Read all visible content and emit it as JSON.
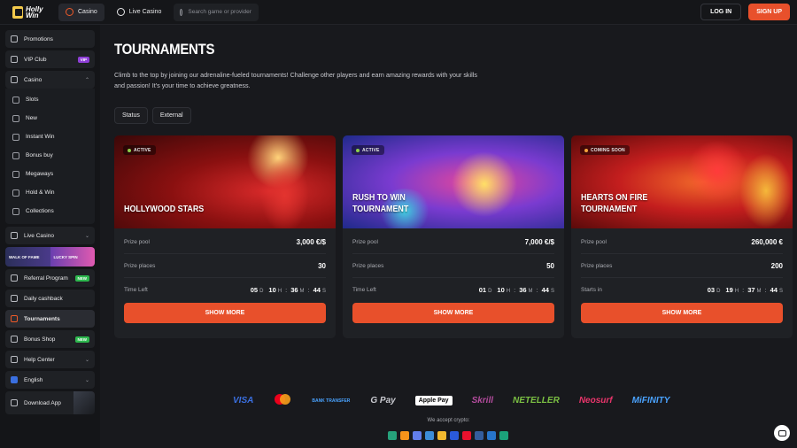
{
  "header": {
    "logo_text": "Holly Win",
    "nav": [
      {
        "label": "Casino",
        "active": true
      },
      {
        "label": "Live Casino",
        "active": false
      }
    ],
    "search_placeholder": "Search game or provider",
    "login_label": "LOG IN",
    "signup_label": "SIGN UP"
  },
  "sidebar": {
    "items": [
      {
        "label": "Promotions"
      },
      {
        "label": "VIP Club",
        "badge": "VIP"
      },
      {
        "label": "Casino",
        "expanded": true
      }
    ],
    "casino_sub": [
      "Slots",
      "New",
      "Instant Win",
      "Bonus buy",
      "Megaways",
      "Hold & Win",
      "Collections"
    ],
    "live_casino": "Live Casino",
    "promo_left": "WALK OF FAME",
    "promo_right": "LUCKY SPIN",
    "referral": "Referral Program",
    "referral_badge": "NEW",
    "cashback": "Daily cashback",
    "tournaments": "Tournaments",
    "bonus_shop": "Bonus Shop",
    "bonus_shop_badge": "NEW",
    "help": "Help Center",
    "language": "English",
    "download": "Download App"
  },
  "main": {
    "title": "TOURNAMENTS",
    "description": "Climb to the top by joining our adrenaline-fueled tournaments! Challenge other players and earn amazing rewards with your skills and passion! It's your time to achieve greatness.",
    "filters": [
      "Status",
      "External"
    ],
    "cards": [
      {
        "status": "ACTIVE",
        "name_line1": "HOLLYWOOD STARS",
        "name_line2": "",
        "prize_label": "Prize pool",
        "prize": "3,000 €/$",
        "places_label": "Prize places",
        "places": "30",
        "time_label": "Time Left",
        "d": "05",
        "h": "10",
        "m": "36",
        "s": "44",
        "button": "SHOW MORE"
      },
      {
        "status": "ACTIVE",
        "name_line1": "RUSH TO WIN",
        "name_line2": "TOURNAMENT",
        "prize_label": "Prize pool",
        "prize": "7,000 €/$",
        "places_label": "Prize places",
        "places": "50",
        "time_label": "Time Left",
        "d": "01",
        "h": "10",
        "m": "36",
        "s": "44",
        "button": "SHOW MORE"
      },
      {
        "status": "COMING SOON",
        "name_line1": "HEARTS ON FIRE",
        "name_line2": "TOURNAMENT",
        "prize_label": "Prize pool",
        "prize": "260,000 €",
        "places_label": "Prize places",
        "places": "200",
        "time_label": "Starts in",
        "d": "03",
        "h": "19",
        "m": "37",
        "s": "44",
        "button": "SHOW MORE"
      }
    ],
    "units": {
      "d": "D",
      "h": "H",
      "m": "M",
      "s": "S"
    }
  },
  "footer": {
    "payments": [
      {
        "name": "VISA",
        "color": "#3a6fe0"
      },
      {
        "name": "Mastercard",
        "color": "#eb001b"
      },
      {
        "name": "BANK TRANSFER",
        "color": "#4aa3ff"
      },
      {
        "name": "G Pay",
        "color": "#c9cad0"
      },
      {
        "name": "Apple Pay",
        "color": "#ffffff"
      },
      {
        "name": "Skrill",
        "color": "#b44c9e"
      },
      {
        "name": "NETELLER",
        "color": "#7bc043"
      },
      {
        "name": "Neosurf",
        "color": "#e8356b"
      },
      {
        "name": "MiFINITY",
        "color": "#4aa3ff"
      }
    ],
    "crypto_label": "We accept crypto:",
    "crypto_colors": [
      "#26a17b",
      "#f7931a",
      "#627eea",
      "#3c8dd8",
      "#f3ba2f",
      "#2a5ada",
      "#e8112d",
      "#345d9d",
      "#2775ca",
      "#1ba27a"
    ]
  }
}
